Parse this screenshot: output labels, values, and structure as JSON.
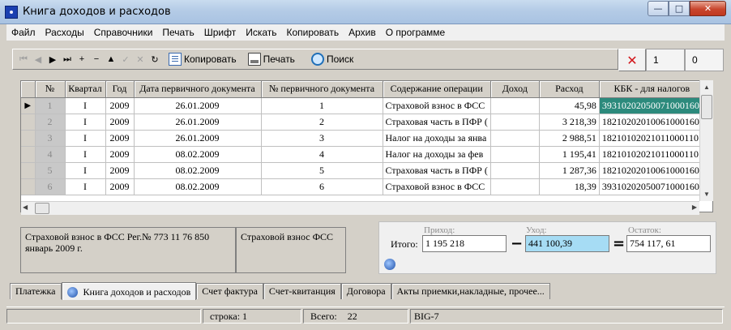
{
  "window": {
    "title": "Книга доходов и расходов",
    "btn_min": "—",
    "btn_max": "□",
    "btn_close": "✕"
  },
  "menu": [
    "Файл",
    "Расходы",
    "Справочники",
    "Печать",
    "Шрифт",
    "Искать",
    "Копировать",
    "Архив",
    "О программе"
  ],
  "toolbar": {
    "nav": [
      "⏮",
      "◀",
      "▶",
      "⏭",
      "+",
      "−",
      "▲",
      "✓",
      "✕",
      "↻"
    ],
    "copy_label": "Копировать",
    "print_label": "Печать",
    "search_label": "Поиск",
    "delete_icon": "✕",
    "counter1": "1",
    "counter2": "0"
  },
  "grid": {
    "columns": [
      "№",
      "Квартал",
      "Год",
      "Дата первичного документа",
      "№ первичного документа",
      "Содержание операции",
      "Доход",
      "Расход",
      "КБК - для налогов"
    ],
    "rows": [
      [
        "1",
        "I",
        "2009",
        "26.01.2009",
        "1",
        "Страховой взнос в ФСС",
        "",
        "45,98",
        "39310202050071000160"
      ],
      [
        "2",
        "I",
        "2009",
        "26.01.2009",
        "2",
        "Страховая часть в ПФР (",
        "",
        "3 218,39",
        "18210202010061000160"
      ],
      [
        "3",
        "I",
        "2009",
        "26.01.2009",
        "3",
        "Налог на доходы за янва",
        "",
        "2 988,51",
        "18210102021011000110"
      ],
      [
        "4",
        "I",
        "2009",
        "08.02.2009",
        "4",
        "Налог на доходы за фев",
        "",
        "1 195,41",
        "18210102021011000110"
      ],
      [
        "5",
        "I",
        "2009",
        "08.02.2009",
        "5",
        "Страховая часть в ПФР (",
        "",
        "1 287,36",
        "18210202010061000160"
      ],
      [
        "6",
        "I",
        "2009",
        "08.02.2009",
        "6",
        "Страховой взнос в ФСС",
        "",
        "18,39",
        "39310202050071000160"
      ]
    ],
    "current_row": 0
  },
  "details": {
    "line1": "Страховой взнос в ФСС  Рег.№  773 11 76 850",
    "line2": "январь 2009 г.",
    "short": "Страховой взнос ФСС"
  },
  "totals": {
    "itogo_label": "Итого:",
    "income_label": "Приход:",
    "expense_label": "Уход:",
    "balance_label": "Остаток:",
    "income": "1 195 218",
    "expense": "441 100,39",
    "balance": "754 117, 61",
    "minus": "−",
    "equals": "="
  },
  "tabs": [
    "Платежка",
    "Книга доходов и расходов",
    "Счет фактура",
    "Счет-квитанция",
    "Договора",
    "Акты приемки,накладные, прочее..."
  ],
  "active_tab": 1,
  "status": {
    "row_label": "строка:",
    "row_value": "1",
    "total_label": "Всего:",
    "total_value": "22",
    "db": "BIG-7"
  }
}
